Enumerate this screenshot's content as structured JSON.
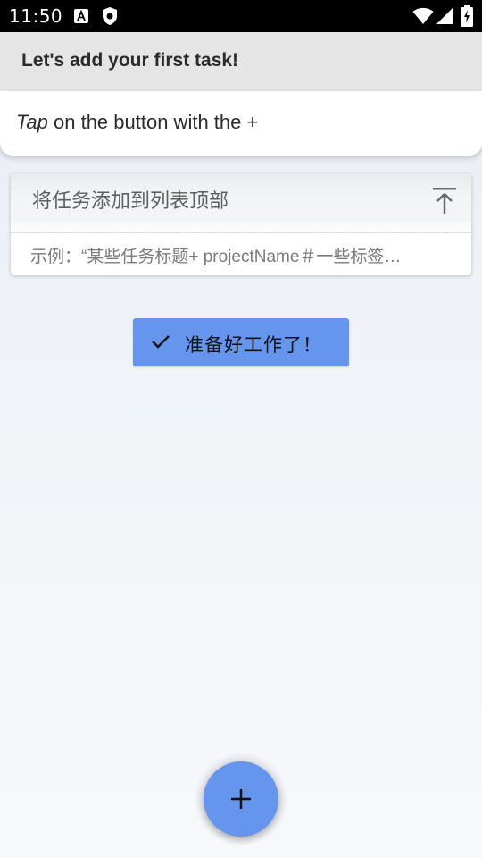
{
  "status_bar": {
    "time": "11:50",
    "icons": [
      "font-a-icon",
      "shield-icon",
      "wifi-icon",
      "signal-icon",
      "battery-icon"
    ]
  },
  "tutorial": {
    "title": "Let's add your first task!",
    "desc_italic": "Tap",
    "desc_rest": " on the button with the +"
  },
  "task_input": {
    "placeholder": "将任务添加到列表顶部",
    "top_icon": "arrow-to-top-icon",
    "example": "示例：“某些任务标题+ projectName＃一些标签…"
  },
  "ready_button": {
    "label": "准备好工作了！",
    "icon": "check-icon"
  },
  "fab": {
    "icon": "plus-icon"
  },
  "colors": {
    "accent": "#6595ec",
    "status_bar": "#000000",
    "banner_header": "#e5e5e5"
  }
}
